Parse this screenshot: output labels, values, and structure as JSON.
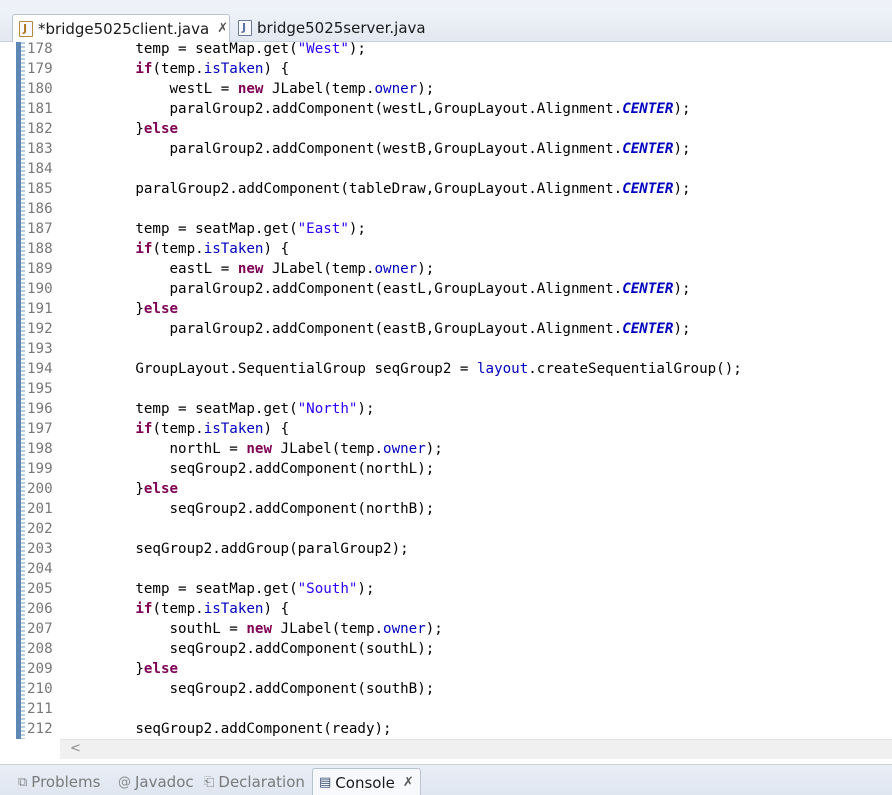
{
  "editor_tabs": [
    {
      "label": "*bridge5025client.java",
      "close": "✗"
    },
    {
      "label": "bridge5025server.java"
    }
  ],
  "view_tabs": [
    {
      "label": "Problems",
      "icon": "problems-icon",
      "glyph": "⧉"
    },
    {
      "label": "Javadoc",
      "icon": "at-icon",
      "glyph": "@"
    },
    {
      "label": "Declaration",
      "icon": "declaration-icon",
      "glyph": "⎗"
    },
    {
      "label": "Console",
      "icon": "console-icon",
      "glyph": "▤",
      "close": "✗"
    }
  ],
  "code_lines": [
    {
      "num": "178",
      "code": "        temp = seatMap.get(\"West\");"
    },
    {
      "num": "179",
      "code": "        if(temp.isTaken) {"
    },
    {
      "num": "180",
      "code": "            westL = new JLabel(temp.owner);"
    },
    {
      "num": "181",
      "code": "            paralGroup2.addComponent(westL,GroupLayout.Alignment.CENTER);"
    },
    {
      "num": "182",
      "code": "        }else"
    },
    {
      "num": "183",
      "code": "            paralGroup2.addComponent(westB,GroupLayout.Alignment.CENTER);"
    },
    {
      "num": "184",
      "code": ""
    },
    {
      "num": "185",
      "code": "        paralGroup2.addComponent(tableDraw,GroupLayout.Alignment.CENTER);"
    },
    {
      "num": "186",
      "code": ""
    },
    {
      "num": "187",
      "code": "        temp = seatMap.get(\"East\");"
    },
    {
      "num": "188",
      "code": "        if(temp.isTaken) {"
    },
    {
      "num": "189",
      "code": "            eastL = new JLabel(temp.owner);"
    },
    {
      "num": "190",
      "code": "            paralGroup2.addComponent(eastL,GroupLayout.Alignment.CENTER);"
    },
    {
      "num": "191",
      "code": "        }else"
    },
    {
      "num": "192",
      "code": "            paralGroup2.addComponent(eastB,GroupLayout.Alignment.CENTER);"
    },
    {
      "num": "193",
      "code": ""
    },
    {
      "num": "194",
      "code": "        GroupLayout.SequentialGroup seqGroup2 = layout.createSequentialGroup();"
    },
    {
      "num": "195",
      "code": ""
    },
    {
      "num": "196",
      "code": "        temp = seatMap.get(\"North\");"
    },
    {
      "num": "197",
      "code": "        if(temp.isTaken) {"
    },
    {
      "num": "198",
      "code": "            northL = new JLabel(temp.owner);"
    },
    {
      "num": "199",
      "code": "            seqGroup2.addComponent(northL);"
    },
    {
      "num": "200",
      "code": "        }else"
    },
    {
      "num": "201",
      "code": "            seqGroup2.addComponent(northB);"
    },
    {
      "num": "202",
      "code": ""
    },
    {
      "num": "203",
      "code": "        seqGroup2.addGroup(paralGroup2);"
    },
    {
      "num": "204",
      "code": ""
    },
    {
      "num": "205",
      "code": "        temp = seatMap.get(\"South\");"
    },
    {
      "num": "206",
      "code": "        if(temp.isTaken) {"
    },
    {
      "num": "207",
      "code": "            southL = new JLabel(temp.owner);"
    },
    {
      "num": "208",
      "code": "            seqGroup2.addComponent(southL);"
    },
    {
      "num": "209",
      "code": "        }else"
    },
    {
      "num": "210",
      "code": "            seqGroup2.addComponent(southB);"
    },
    {
      "num": "211",
      "code": ""
    },
    {
      "num": "212",
      "code": "        seqGroup2.addComponent(ready);"
    }
  ],
  "scroll_left_glyph": "<",
  "colors": {
    "keyword": "#7f0055",
    "string": "#2a00ff",
    "field": "#0000c0",
    "line_number": "#787878",
    "change_bar": "#5d87b4"
  }
}
